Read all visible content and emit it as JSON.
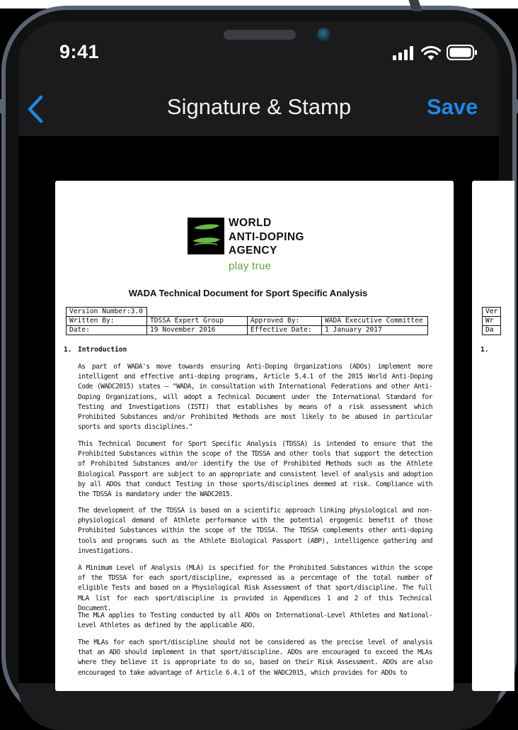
{
  "status_bar": {
    "time": "9:41"
  },
  "nav": {
    "title": "Signature & Stamp",
    "save_label": "Save"
  },
  "colors": {
    "accent": "#1e88e5",
    "logo_green": "#5aa53e"
  },
  "icons": [
    "back-chevron-icon",
    "signal-icon",
    "wifi-icon",
    "battery-icon"
  ],
  "document": {
    "logo": {
      "line1": "WORLD",
      "line2": "ANTI-DOPING",
      "line3": "AGENCY",
      "tagline": "play true"
    },
    "title": "WADA Technical Document for Sport Specific Analysis",
    "meta": {
      "version": "Version Number:3.0",
      "written_by_label": "Written By:",
      "written_by": "TDSSA Expert Group",
      "approved_by_label": "Approved By:",
      "approved_by": "WADA Executive Committee",
      "date_label": "Date:",
      "date": "19 November 2016",
      "effective_label": "Effective Date:",
      "effective": "1 January 2017"
    },
    "section_number": "1.",
    "section_title": "Introduction",
    "paragraphs": [
      "As part of WADA's move towards ensuring Anti-Doping Organizations (ADOs) implement more intelligent and effective anti-doping programs, Article 5.4.1 of the 2015 World Anti-Doping Code (WADC2015) states – \"WADA, in consultation with International Federations and other Anti-Doping Organizations, will adopt a Technical Document under the International Standard for Testing and Investigations (ISTI) that establishes by means of a risk assessment which Prohibited Substances and/or Prohibited Methods are most likely to be abused in particular sports and sports disciplines.\"",
      "This Technical Document for Sport Specific Analysis (TDSSA) is intended to ensure that the Prohibited Substances within the scope of the TDSSA and other tools that support the detection of Prohibited Substances and/or identify the Use of Prohibited Methods such as the Athlete Biological Passport are subject to an appropriate and consistent level of analysis and adoption by all ADOs that conduct Testing in those sports/disciplines deemed at risk. Compliance with the TDSSA is mandatory under the WADC2015.",
      "The development of the TDSSA is based on a scientific approach linking physiological and non-physiological demand of Athlete performance with the potential ergogenic benefit of those Prohibited Substances within the scope of the TDSSA. The TDSSA complements other anti-doping tools and programs such as the Athlete Biological Passport (ABP), intelligence gathering and investigations.",
      "A Minimum Level of Analysis (MLA) is specified for the Prohibited Substances within the scope of the TDSSA for each sport/discipline, expressed as a percentage of the total number of eligible Tests and based on a Physiological Risk Assessment of that sport/discipline. The full MLA list for each sport/discipline is provided in Appendices 1 and 2 of this Technical Document.",
      "The MLA applies to Testing conducted by all ADOs on International-Level Athletes and National-Level Athletes as defined by the applicable ADO.",
      "The MLAs for each sport/discipline should not be considered as the precise level of analysis that an ADO should implement in that sport/discipline. ADOs are encouraged to exceed the MLAs where they believe it is appropriate to do so, based on their Risk Assessment. ADOs are also encouraged to take advantage of Article 6.4.1 of the WADC2015, which provides for ADOs to"
    ],
    "page2": {
      "row1": "Ver",
      "row2": "Wr",
      "row3": "Da",
      "section": "1."
    }
  }
}
